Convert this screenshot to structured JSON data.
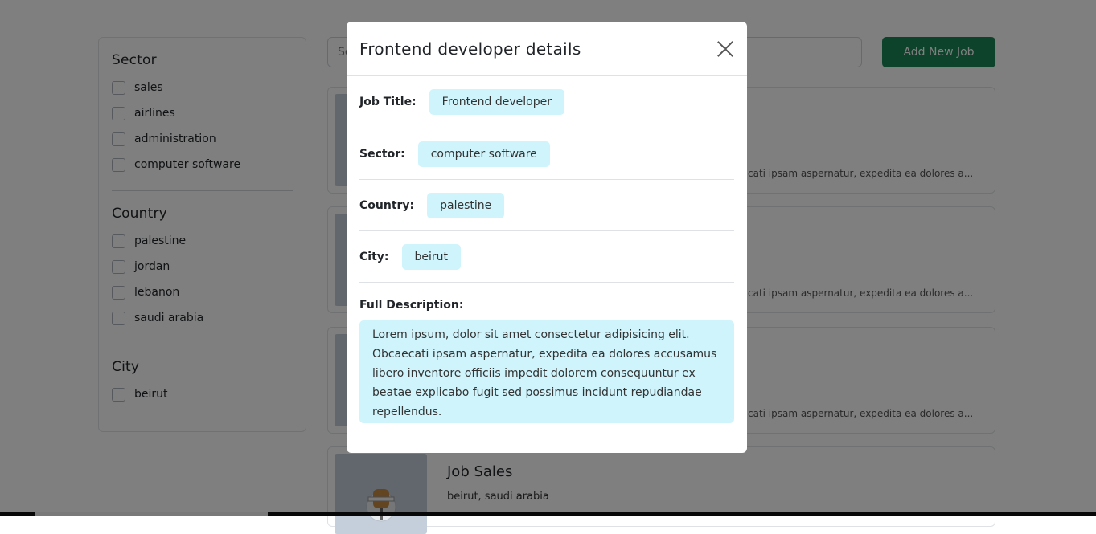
{
  "filters": {
    "sector": {
      "heading": "Sector",
      "options": [
        "sales",
        "airlines",
        "administration",
        "computer software"
      ]
    },
    "country": {
      "heading": "Country",
      "options": [
        "palestine",
        "jordan",
        "lebanon",
        "saudi arabia"
      ]
    },
    "city": {
      "heading": "City",
      "options": [
        "beirut"
      ]
    }
  },
  "search": {
    "placeholder": "Se"
  },
  "add_job_label": "Add New Job",
  "job_cards": [
    {
      "desc": "cati ipsam aspernatur, expedita ea dolores a..."
    },
    {
      "desc": "cati ipsam aspernatur, expedita ea dolores a..."
    },
    {
      "desc": "cati ipsam aspernatur, expedita ea dolores a..."
    },
    {
      "title": "Job Sales",
      "location": "beirut, saudi arabia"
    }
  ],
  "modal": {
    "title": "Frontend developer details",
    "fields": {
      "job_title": {
        "label": "Job Title:",
        "value": "Frontend developer"
      },
      "sector": {
        "label": "Sector:",
        "value": "computer software"
      },
      "country": {
        "label": "Country:",
        "value": "palestine"
      },
      "city": {
        "label": "City:",
        "value": "beirut"
      }
    },
    "description_label": "Full Description:",
    "description_lines": [
      "Lorem ipsum, dolor sit amet consectetur adipisicing elit.",
      "Obcaecati ipsam aspernatur, expedita ea dolores accusamus",
      "libero inventore officiis impedit dolorem consequuntur ex",
      "beatae explicabo fugit sed possimus incidunt repudiandae",
      "repellendus."
    ]
  }
}
